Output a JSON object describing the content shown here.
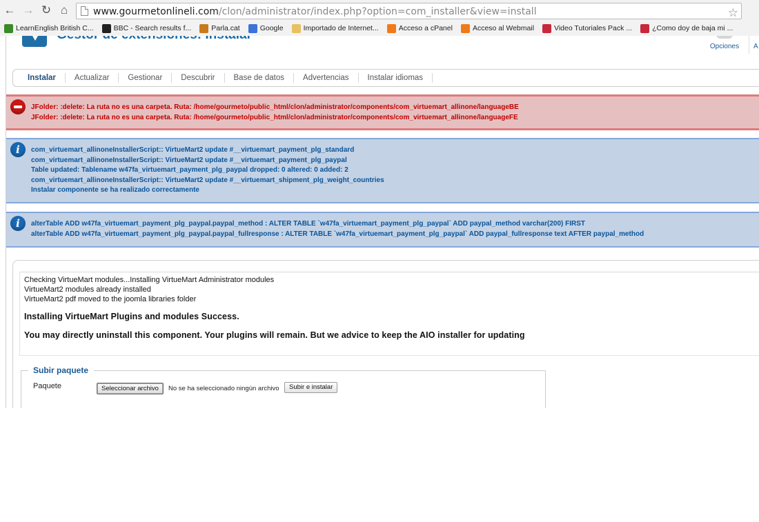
{
  "browser": {
    "url_host": "www.gourmetonlineli.com",
    "url_path": "/clon/administrator/index.php?option=com_installer&view=install",
    "bookmarks": [
      {
        "label": "LearnEnglish British C...",
        "icon": "grid-icon",
        "color": "#3a8a2a"
      },
      {
        "label": "BBC - Search results f...",
        "icon": "bbc-icon",
        "color": "#222222"
      },
      {
        "label": "Parla.cat",
        "icon": "person-icon",
        "color": "#c87a1a"
      },
      {
        "label": "Google",
        "icon": "google-icon",
        "color": "#3b73d8"
      },
      {
        "label": "Importado de Internet...",
        "icon": "folder-icon",
        "color": "#e8c060"
      },
      {
        "label": "Acceso a cPanel",
        "icon": "cpanel-icon",
        "color": "#f07a1a"
      },
      {
        "label": "Acceso al Webmail",
        "icon": "cpanel-icon",
        "color": "#f07a1a"
      },
      {
        "label": "Video Tutoriales Pack ...",
        "icon": "w-icon",
        "color": "#c8283a"
      },
      {
        "label": "¿Como doy de baja mi ...",
        "icon": "w-icon",
        "color": "#c8283a"
      }
    ]
  },
  "toolbar": {
    "title": "Gestor de extensiones: Instalar",
    "options_label": "Opciones",
    "truncated_label": "A"
  },
  "submenu": [
    "Instalar",
    "Actualizar",
    "Gestionar",
    "Descubrir",
    "Base de datos",
    "Advertencias",
    "Instalar idiomas"
  ],
  "messages": {
    "error": [
      "JFolder: :delete: La ruta no es una carpeta. Ruta: /home/gourmeto/public_html/clon/administrator/components/com_virtuemart_allinone/languageBE",
      "JFolder: :delete: La ruta no es una carpeta. Ruta: /home/gourmeto/public_html/clon/administrator/components/com_virtuemart_allinone/languageFE"
    ],
    "info1": [
      "com_virtuemart_allinoneInstallerScript:: VirtueMart2 update #__virtuemart_payment_plg_standard",
      "com_virtuemart_allinoneInstallerScript:: VirtueMart2 update #__virtuemart_payment_plg_paypal",
      "Table updated: Tablename w47fa_virtuemart_payment_plg_paypal dropped: 0 altered: 0 added: 2",
      "com_virtuemart_allinoneInstallerScript:: VirtueMart2 update #__virtuemart_shipment_plg_weight_countries",
      "Instalar componente se ha realizado correctamente"
    ],
    "info2": [
      "alterTable ADD w47fa_virtuemart_payment_plg_paypal.paypal_method : ALTER TABLE `w47fa_virtuemart_payment_plg_paypal` ADD paypal_method varchar(200) FIRST",
      "alterTable ADD w47fa_virtuemart_payment_plg_paypal.paypal_fullresponse : ALTER TABLE `w47fa_virtuemart_payment_plg_paypal` ADD paypal_fullresponse text AFTER paypal_method"
    ]
  },
  "install_log": {
    "lines": [
      "Checking VirtueMart modules...Installing VirtueMart Administrator modules",
      "VirtueMart2 modules already installed",
      "VirtueMart2 pdf moved to the joomla libraries folder"
    ],
    "success": "Installing VirtueMart Plugins and modules Success.",
    "note": "You may directly uninstall this component. Your plugins will remain. But we advice to keep the AIO installer for updating"
  },
  "upload": {
    "legend": "Subir paquete",
    "package_label": "Paquete",
    "choose_button": "Seleccionar archivo",
    "no_file_text": "No se ha seleccionado ningún archivo",
    "submit_button": "Subir e instalar"
  }
}
